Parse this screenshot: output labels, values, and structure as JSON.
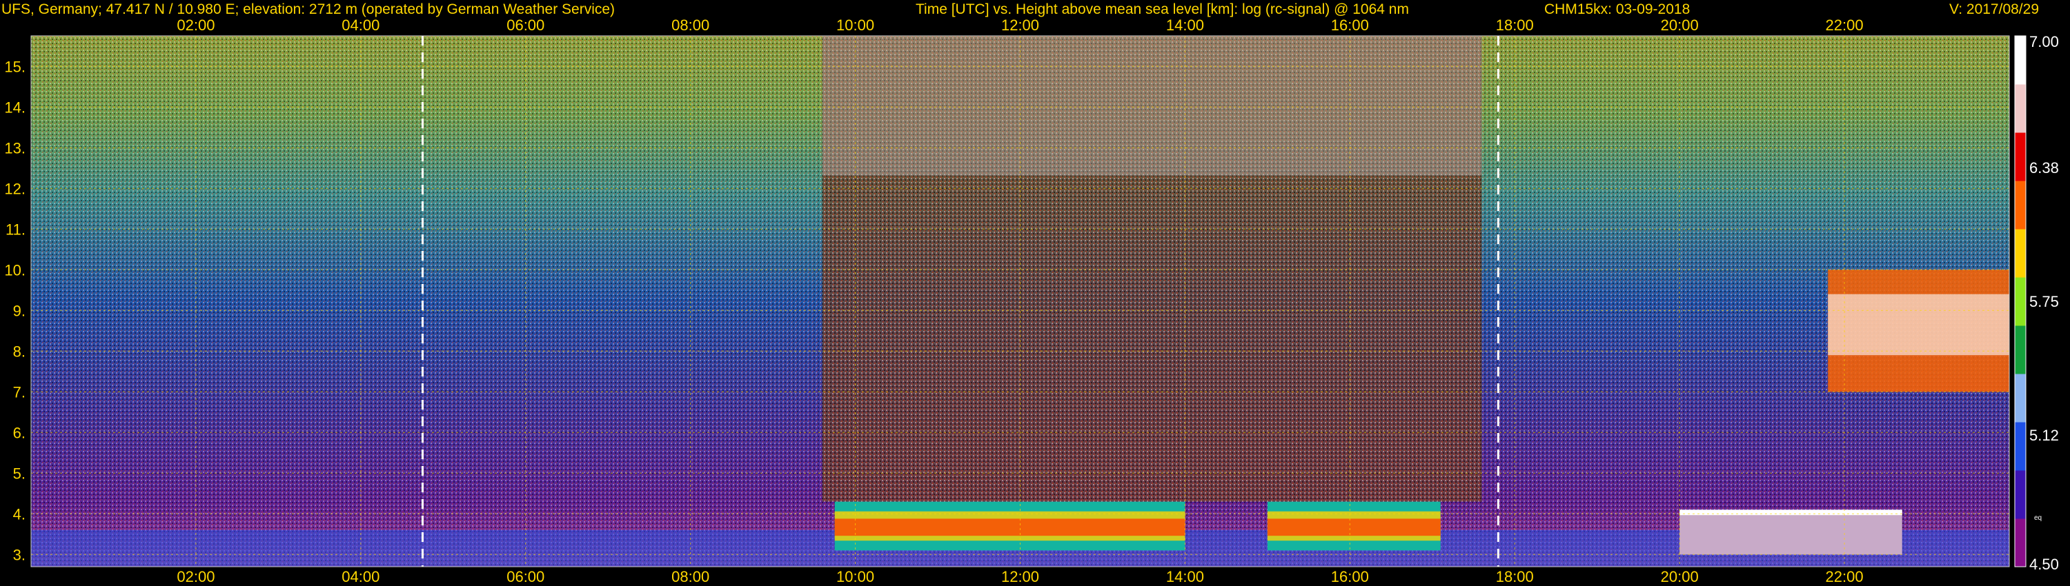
{
  "header": {
    "site": "UFS, Germany; 47.417 N / 10.980 E; elevation: 2712 m  (operated by German Weather Service)",
    "axes_desc": "Time [UTC] vs. Height above mean sea level [km]: log (rc-signal) @ 1064 nm",
    "instrument": "CHM15kx: 03-09-2018",
    "version": "V: 2017/08/29"
  },
  "colors": {
    "background": "#000000",
    "text": "#ffd700",
    "grid": "#ffd700",
    "sun_lines": "#ffffff"
  },
  "chart_data": {
    "type": "heatmap",
    "title": "Time [UTC] vs. Height above mean sea level [km]: log (rc-signal) @ 1064 nm",
    "xlabel": "",
    "ylabel": "",
    "x_range_hours": [
      0,
      24
    ],
    "y_range_km": [
      2.7,
      15.75
    ],
    "x_ticks": [
      "02:00",
      "04:00",
      "06:00",
      "08:00",
      "10:00",
      "12:00",
      "14:00",
      "16:00",
      "18:00",
      "20:00",
      "22:00"
    ],
    "y_ticks": [
      "3.",
      "4.",
      "5.",
      "6.",
      "7.",
      "8.",
      "9.",
      "10.",
      "11.",
      "12.",
      "13.",
      "14.",
      "15."
    ],
    "dashed_lines_hours": [
      4.75,
      17.8
    ],
    "grid": true,
    "colorbar": {
      "range": [
        4.5,
        7.0
      ],
      "labels": [
        "7.00",
        "6.38",
        "5.75",
        "5.12",
        "4.50"
      ],
      "small_label": "eq",
      "stops": [
        "#8a0d8a",
        "#3c14b4",
        "#1e50e6",
        "#8ab4f0",
        "#14a03c",
        "#8ce61e",
        "#ffd200",
        "#ff6400",
        "#e60000",
        "#f0c8c8",
        "#ffffff"
      ]
    },
    "features": [
      {
        "type": "boundary_layer",
        "t_start": 0.0,
        "t_end": 24.0,
        "height_km": [
          2.7,
          3.6
        ],
        "value": 5.0
      },
      {
        "type": "convective_cloud_band",
        "t_start": 9.75,
        "t_end": 14.0,
        "height_km": [
          3.1,
          4.3
        ],
        "value": 6.6
      },
      {
        "type": "convective_cloud_band",
        "t_start": 15.0,
        "t_end": 17.1,
        "height_km": [
          3.1,
          4.3
        ],
        "value": 6.6
      },
      {
        "type": "high_noise_daytime",
        "t_start": 9.6,
        "t_end": 17.6,
        "height_km": [
          4.3,
          15.75
        ],
        "value": 6.4
      },
      {
        "type": "cirrus",
        "t_start": 21.8,
        "t_end": 24.0,
        "height_km": [
          7.0,
          10.0
        ],
        "value": 6.7
      },
      {
        "type": "low_cloud",
        "t_start": 20.0,
        "t_end": 22.7,
        "height_km": [
          3.0,
          4.1
        ],
        "value": 6.9
      }
    ]
  }
}
